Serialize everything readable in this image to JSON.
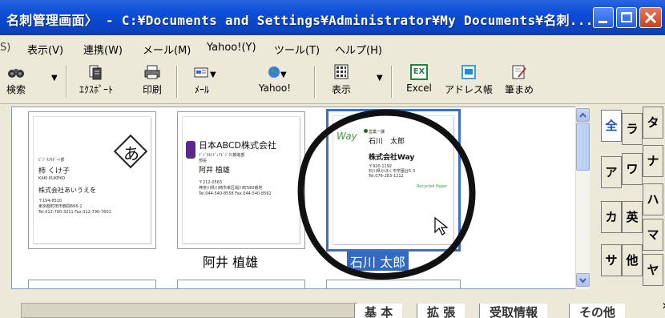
{
  "window": {
    "title": "名刺管理画面〉 - C:¥Documents and Settings¥Administrator¥My Documents¥名刺..."
  },
  "menu": {
    "items": [
      "表示(V)",
      "連携(W)",
      "メール(M)",
      "Yahoo!(Y)",
      "ツール(T)",
      "ヘルプ(H)"
    ]
  },
  "toolbar": {
    "search": "検索",
    "export": "ｴｸｽﾎﾟｰﾄ",
    "print": "印刷",
    "mail": "ﾒｰﾙ",
    "yahoo": "Yahoo!",
    "view": "表示",
    "excel": "Excel",
    "address_book": "アドレス帳",
    "hikkimame": "筆まめ",
    "excel_badge": "EX"
  },
  "cards": [
    {
      "name": "",
      "company": "株式会社あいうえを",
      "person": "柿 くけ子",
      "person_roman": "KAKI KUKEKO",
      "small_top": "ﾋﾞｼﾞﾈｽｻﾎﾟｰﾄ部",
      "addr1": "〒194-8510",
      "addr2": "東京都町田市鶴間666-1",
      "tel": "Tel.012-790-3211 Fax.012-790-7601",
      "logo": "あ"
    },
    {
      "name": "阿井 植雄",
      "company": "日本ABCD株式会社",
      "dept": "ﾃﾞｼﾞﾀﾙﾒﾃﾞｨｱﾋﾞｼﾞﾈｽ推進部",
      "title": "部長",
      "person": "阿井 植雄",
      "addr1": "〒212-0583",
      "addr2": "神奈川県川崎市幸区堀川町580番地",
      "tel": "Tel.044-540-8558 Fax.044-540-8561"
    },
    {
      "name": "石川 太郎",
      "company": "株式会社Way",
      "brand": "Way",
      "title": "営業一課",
      "person": "石川　太郎",
      "addr1": "〒920-1192",
      "addr2": "石川県かほく市学園台5-3",
      "tel": "Tel.076-283-1212",
      "recycle": "Recycled Paper"
    }
  ],
  "index_tabs": [
    "全",
    "ラ",
    "タ",
    "ア",
    "ワ",
    "ナ",
    "カ",
    "英",
    "ハ",
    "サ",
    "他",
    "マ",
    "ヤ"
  ],
  "bottom_tabs": [
    "基 本",
    "拡 張",
    "受取情報",
    "その他"
  ],
  "colors": {
    "titlebar": "#0c4fd8",
    "selection": "#316ac5",
    "active_index": "#1a4fd0"
  }
}
